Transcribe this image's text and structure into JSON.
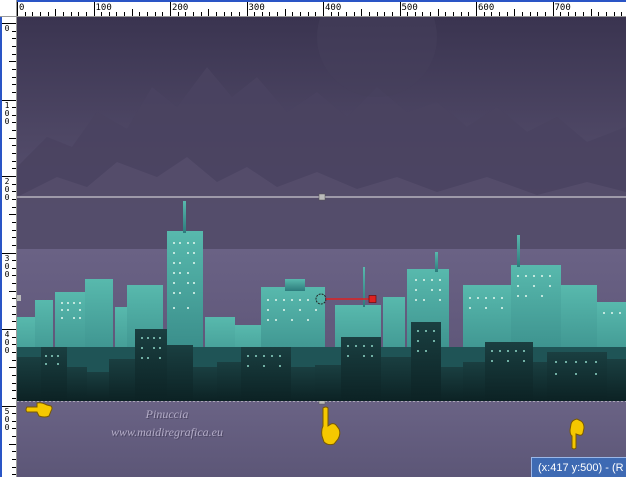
{
  "rulers": {
    "top_labels": [
      "0",
      "100",
      "200",
      "300",
      "400",
      "500",
      "600",
      "700"
    ],
    "left_labels": [
      "0",
      "100",
      "200",
      "300",
      "400",
      "500"
    ]
  },
  "watermark": {
    "line1": "Pinuccia",
    "line2": "www.maidiregrafica.eu"
  },
  "status_bar": {
    "text": "(x:417 y:500) - (R"
  },
  "colors": {
    "sky_top": "#3d3651",
    "sky_mid": "#5c5574",
    "band": "#6f6789",
    "city_teal": "#2a6e70",
    "city_light": "#63c4b5",
    "city_dark": "#0f2a2c",
    "status_bg": "#3e6ab3",
    "pointer_yellow": "#f5c800"
  },
  "icons": [
    "pointing-hand-left-icon",
    "pointing-hand-down-icon",
    "pointing-hand-down-icon",
    "perspective-handle-icon"
  ]
}
